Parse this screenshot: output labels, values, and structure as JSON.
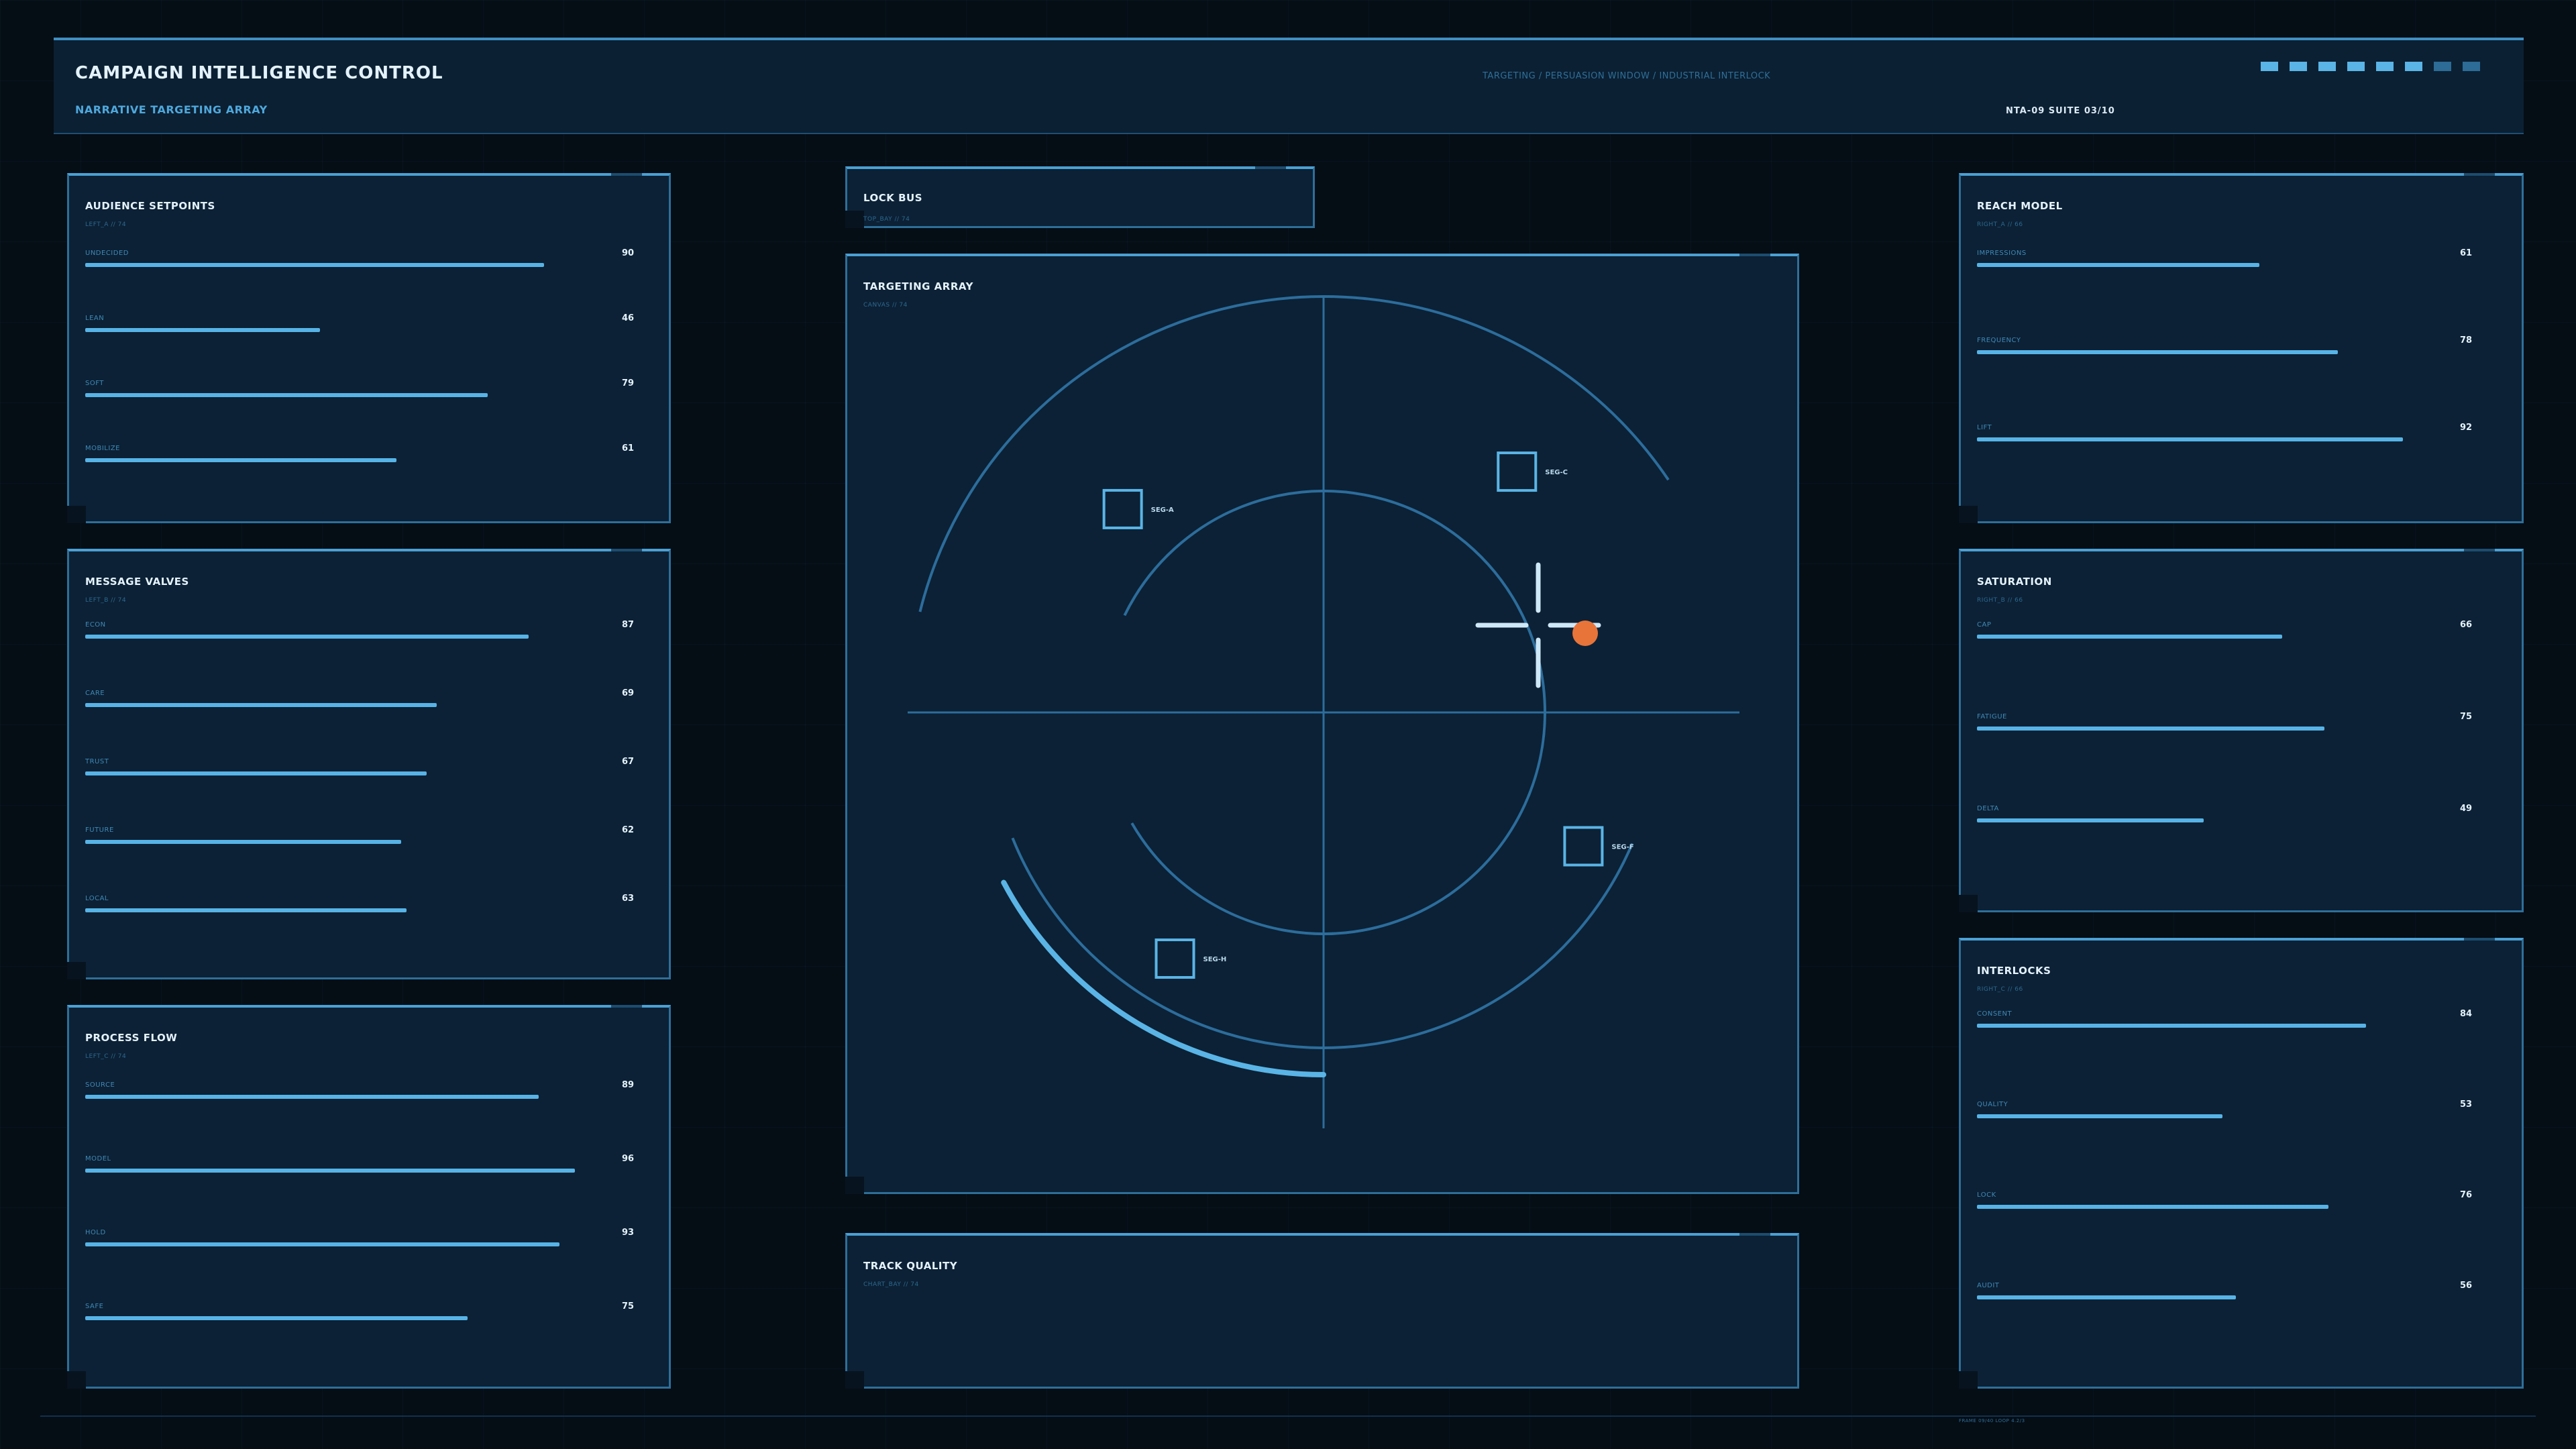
{
  "header": {
    "title": "CAMPAIGN INTELLIGENCE CONTROL",
    "subtitle": "NARRATIVE TARGETING ARRAY",
    "path": "TARGETING / PERSUASION WINDOW / INDUSTRIAL INTERLOCK",
    "suite": "NTA-09  SUITE 03/10",
    "indicators": [
      1,
      1,
      1,
      1,
      1,
      1,
      0,
      0
    ]
  },
  "panels": {
    "audience": {
      "title": "AUDIENCE SETPOINTS",
      "subtitle": "LEFT_A // 74",
      "metrics": [
        {
          "label": "UNDECIDED",
          "value": 90
        },
        {
          "label": "LEAN",
          "value": 46
        },
        {
          "label": "SOFT",
          "value": 79
        },
        {
          "label": "MOBILIZE",
          "value": 61
        }
      ]
    },
    "message": {
      "title": "MESSAGE VALVES",
      "subtitle": "LEFT_B // 74",
      "metrics": [
        {
          "label": "ECON",
          "value": 87
        },
        {
          "label": "CARE",
          "value": 69
        },
        {
          "label": "TRUST",
          "value": 67
        },
        {
          "label": "FUTURE",
          "value": 62
        },
        {
          "label": "LOCAL",
          "value": 63
        }
      ]
    },
    "process": {
      "title": "PROCESS FLOW",
      "subtitle": "LEFT_C // 74",
      "metrics": [
        {
          "label": "SOURCE",
          "value": 89
        },
        {
          "label": "MODEL",
          "value": 96
        },
        {
          "label": "HOLD",
          "value": 93
        },
        {
          "label": "SAFE",
          "value": 75
        }
      ]
    },
    "lockbus": {
      "title": "LOCK BUS",
      "subtitle": "TOP_BAY // 74"
    },
    "targeting": {
      "title": "TARGETING ARRAY",
      "subtitle": "CANVAS // 74",
      "segments": [
        {
          "id": "SEG-A",
          "nx": 0.29,
          "ny": 0.27
        },
        {
          "id": "SEG-C",
          "nx": 0.705,
          "ny": 0.23
        },
        {
          "id": "SEG-F",
          "nx": 0.775,
          "ny": 0.63
        },
        {
          "id": "SEG-H",
          "nx": 0.345,
          "ny": 0.75
        }
      ],
      "lock_status": "locked"
    },
    "track": {
      "title": "TRACK QUALITY",
      "subtitle": "CHART_BAY // 74"
    },
    "reach": {
      "title": "REACH MODEL",
      "subtitle": "RIGHT_A // 66",
      "metrics": [
        {
          "label": "IMPRESSIONS",
          "value": 61
        },
        {
          "label": "FREQUENCY",
          "value": 78
        },
        {
          "label": "LIFT",
          "value": 92
        }
      ]
    },
    "saturation": {
      "title": "SATURATION",
      "subtitle": "RIGHT_B // 66",
      "metrics": [
        {
          "label": "CAP",
          "value": 66
        },
        {
          "label": "FATIGUE",
          "value": 75
        },
        {
          "label": "DELTA",
          "value": 49
        }
      ]
    },
    "interlocks": {
      "title": "INTERLOCKS",
      "subtitle": "RIGHT_C // 66",
      "metrics": [
        {
          "label": "CONSENT",
          "value": 84
        },
        {
          "label": "QUALITY",
          "value": 53
        },
        {
          "label": "LOCK",
          "value": 76
        },
        {
          "label": "AUDIT",
          "value": 56
        }
      ]
    }
  },
  "footer": {
    "text": "FRAME 09/40  LOOP 4.2/3"
  },
  "colors": {
    "accent": "#57b3e6",
    "panel": "#0c2135",
    "border": "#2e6f99",
    "target": "#e8743a"
  }
}
